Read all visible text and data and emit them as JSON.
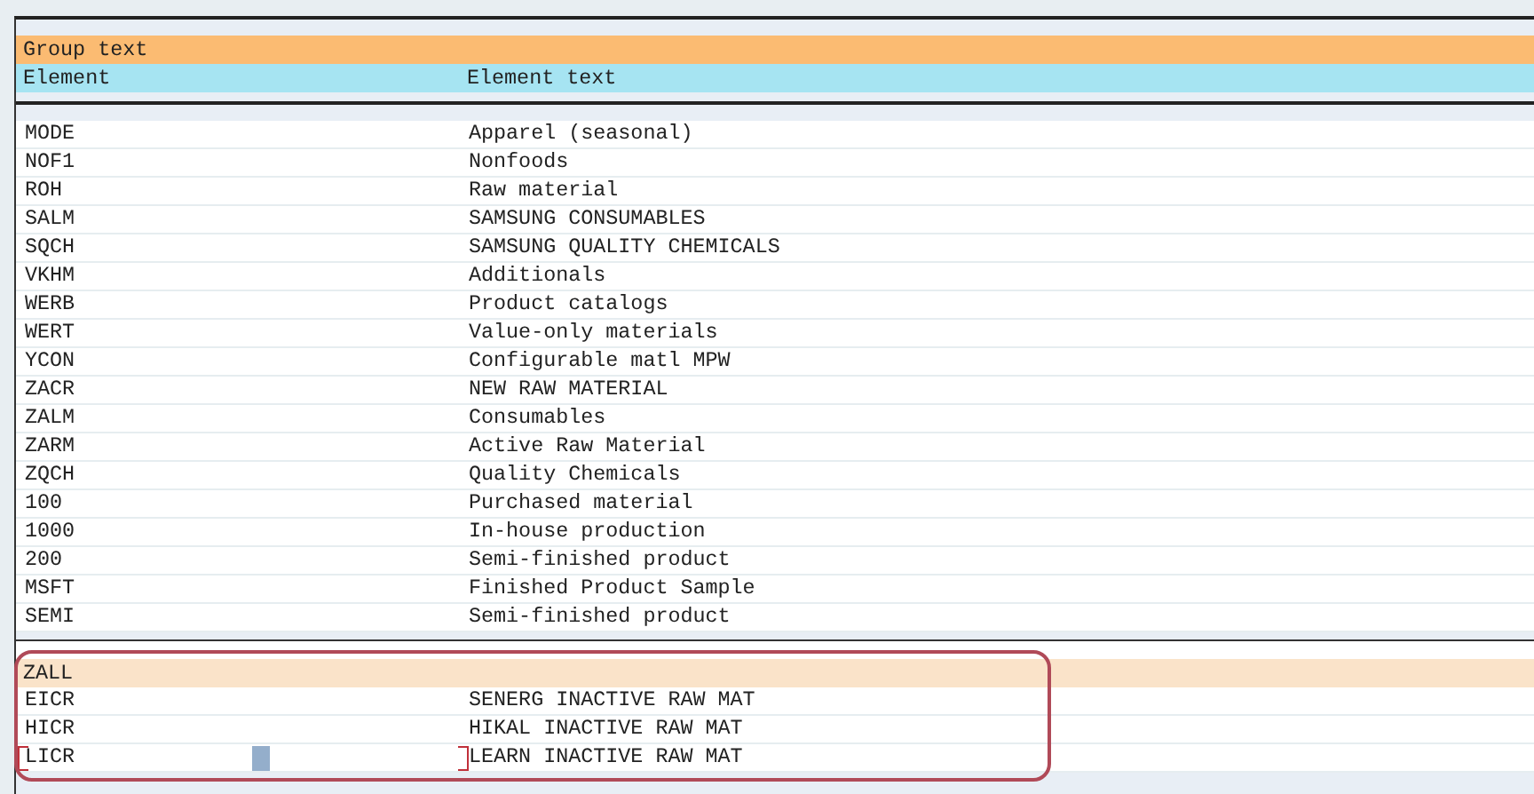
{
  "group_header": "Group text",
  "columns": [
    "Element",
    "Element text"
  ],
  "sections": [
    {
      "annotated": false,
      "rows": [
        {
          "element": "MODE",
          "text": "Apparel (seasonal)",
          "focused": false
        },
        {
          "element": "NOF1",
          "text": "Nonfoods",
          "focused": false
        },
        {
          "element": "ROH",
          "text": "Raw material",
          "focused": false
        },
        {
          "element": "SALM",
          "text": "SAMSUNG CONSUMABLES",
          "focused": false
        },
        {
          "element": "SQCH",
          "text": "SAMSUNG QUALITY CHEMICALS",
          "focused": false
        },
        {
          "element": "VKHM",
          "text": "Additionals",
          "focused": false
        },
        {
          "element": "WERB",
          "text": "Product catalogs",
          "focused": false
        },
        {
          "element": "WERT",
          "text": "Value-only materials",
          "focused": false
        },
        {
          "element": "YCON",
          "text": "Configurable matl MPW",
          "focused": false
        },
        {
          "element": "ZACR",
          "text": "NEW RAW MATERIAL",
          "focused": false
        },
        {
          "element": "ZALM",
          "text": "Consumables",
          "focused": false
        },
        {
          "element": "ZARM",
          "text": "Active Raw Material",
          "focused": false
        },
        {
          "element": "ZQCH",
          "text": "Quality Chemicals",
          "focused": false
        },
        {
          "element": "100",
          "text": "Purchased material",
          "focused": false
        },
        {
          "element": "1000",
          "text": "In-house production",
          "focused": false
        },
        {
          "element": "200",
          "text": "Semi-finished product",
          "focused": false
        },
        {
          "element": "MSFT",
          "text": "Finished Product Sample",
          "focused": false
        },
        {
          "element": "SEMI",
          "text": "Semi-finished product",
          "focused": false
        }
      ]
    },
    {
      "name": "ZALL",
      "annotated": true,
      "rows": [
        {
          "element": "EICR",
          "text": "SENERG INACTIVE RAW MAT",
          "focused": false
        },
        {
          "element": "HICR",
          "text": "HIKAL INACTIVE RAW MAT",
          "focused": false
        },
        {
          "element": "LICR",
          "text": "LEARN INACTIVE RAW MAT",
          "focused": true
        }
      ]
    }
  ]
}
